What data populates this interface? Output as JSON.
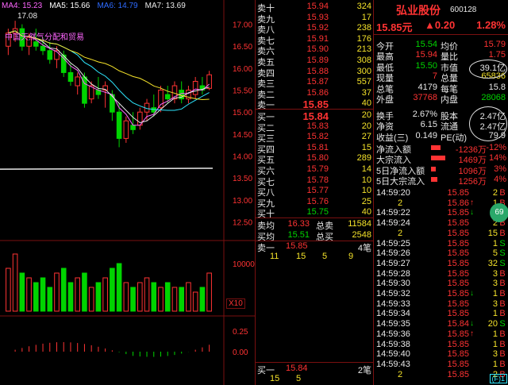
{
  "ma_legend": [
    {
      "label": "MA4: 15.23",
      "color": "#ff66ff"
    },
    {
      "label": "MA5: 15.66",
      "color": "#ffffff"
    },
    {
      "label": "MA6: 14.79",
      "color": "#2e6bff"
    },
    {
      "label": "MA7: 13.69",
      "color": "#e8e8e8"
    }
  ],
  "chart": {
    "high_marker": "17.08",
    "overlay_text": "中国天然气分配和贸易",
    "price_axis": [
      "17.00",
      "16.50",
      "16.00",
      "15.50",
      "15.00",
      "14.50",
      "14.00",
      "13.50",
      "13.00",
      "12.50"
    ],
    "volume_axis": [
      "10000"
    ],
    "volume_unit": "X10",
    "macd_axis": [
      "0.25",
      "0.00"
    ],
    "period_label": "日线"
  },
  "chart_data": {
    "type": "candlestick",
    "candles": [
      {
        "o": 16.5,
        "h": 16.9,
        "l": 16.3,
        "c": 16.8
      },
      {
        "o": 16.8,
        "h": 17.08,
        "l": 16.6,
        "c": 16.9
      },
      {
        "o": 16.9,
        "h": 17.0,
        "l": 16.4,
        "c": 16.5
      },
      {
        "o": 16.5,
        "h": 16.8,
        "l": 16.3,
        "c": 16.7
      },
      {
        "o": 16.6,
        "h": 16.9,
        "l": 16.4,
        "c": 16.5
      },
      {
        "o": 16.5,
        "h": 16.7,
        "l": 16.3,
        "c": 16.4
      },
      {
        "o": 16.4,
        "h": 16.6,
        "l": 16.1,
        "c": 16.2
      },
      {
        "o": 16.2,
        "h": 16.5,
        "l": 16.0,
        "c": 16.4
      },
      {
        "o": 16.3,
        "h": 16.4,
        "l": 15.8,
        "c": 15.9
      },
      {
        "o": 15.9,
        "h": 16.1,
        "l": 15.6,
        "c": 15.7
      },
      {
        "o": 15.6,
        "h": 15.9,
        "l": 15.4,
        "c": 15.8
      },
      {
        "o": 15.8,
        "h": 15.9,
        "l": 15.1,
        "c": 15.2
      },
      {
        "o": 15.3,
        "h": 15.7,
        "l": 15.2,
        "c": 15.6
      },
      {
        "o": 15.5,
        "h": 15.8,
        "l": 15.3,
        "c": 15.4
      },
      {
        "o": 15.5,
        "h": 15.7,
        "l": 15.1,
        "c": 15.6
      },
      {
        "o": 15.4,
        "h": 15.5,
        "l": 14.8,
        "c": 15.0
      },
      {
        "o": 15.0,
        "h": 15.2,
        "l": 14.2,
        "c": 14.4
      },
      {
        "o": 14.4,
        "h": 14.9,
        "l": 14.3,
        "c": 14.8
      },
      {
        "o": 14.7,
        "h": 15.0,
        "l": 14.5,
        "c": 14.6
      },
      {
        "o": 14.7,
        "h": 15.1,
        "l": 14.6,
        "c": 15.0
      },
      {
        "o": 15.0,
        "h": 15.3,
        "l": 14.8,
        "c": 15.2
      },
      {
        "o": 15.1,
        "h": 15.4,
        "l": 14.9,
        "c": 15.0
      },
      {
        "o": 15.1,
        "h": 15.6,
        "l": 15.0,
        "c": 15.5
      },
      {
        "o": 15.4,
        "h": 15.6,
        "l": 15.2,
        "c": 15.3
      },
      {
        "o": 15.3,
        "h": 15.7,
        "l": 15.2,
        "c": 15.6
      },
      {
        "o": 15.5,
        "h": 15.7,
        "l": 15.2,
        "c": 15.3
      },
      {
        "o": 15.3,
        "h": 15.6,
        "l": 15.2,
        "c": 15.5
      },
      {
        "o": 15.4,
        "h": 15.8,
        "l": 15.3,
        "c": 15.7
      },
      {
        "o": 15.6,
        "h": 15.8,
        "l": 15.4,
        "c": 15.5
      },
      {
        "o": 15.54,
        "h": 15.94,
        "l": 15.5,
        "c": 15.85
      }
    ],
    "volumes": [
      9,
      12,
      8,
      7,
      6,
      7,
      5,
      8,
      9,
      6,
      7,
      8,
      5,
      6,
      7,
      9,
      10,
      6,
      5,
      6,
      7,
      6,
      5,
      6,
      5,
      5,
      6,
      4,
      5,
      8
    ],
    "price_range": [
      12.4,
      17.3
    ],
    "volume_max": 14
  },
  "order_book": {
    "asks": [
      {
        "label": "卖十",
        "price": "15.94",
        "vol": "324"
      },
      {
        "label": "卖九",
        "price": "15.93",
        "vol": "17"
      },
      {
        "label": "卖八",
        "price": "15.92",
        "vol": "238"
      },
      {
        "label": "卖七",
        "price": "15.91",
        "vol": "176"
      },
      {
        "label": "卖六",
        "price": "15.90",
        "vol": "213"
      },
      {
        "label": "卖五",
        "price": "15.89",
        "vol": "308"
      },
      {
        "label": "卖四",
        "price": "15.88",
        "vol": "300"
      },
      {
        "label": "卖三",
        "price": "15.87",
        "vol": "557"
      },
      {
        "label": "卖二",
        "price": "15.86",
        "vol": "37"
      },
      {
        "label": "卖一",
        "price": "15.85",
        "vol": "40"
      }
    ],
    "bids": [
      {
        "label": "买一",
        "price": "15.84",
        "vol": "20"
      },
      {
        "label": "买二",
        "price": "15.83",
        "vol": "20"
      },
      {
        "label": "买三",
        "price": "15.82",
        "vol": "27"
      },
      {
        "label": "买四",
        "price": "15.81",
        "vol": "15"
      },
      {
        "label": "买五",
        "price": "15.80",
        "vol": "289"
      },
      {
        "label": "买六",
        "price": "15.79",
        "vol": "14"
      },
      {
        "label": "买七",
        "price": "15.78",
        "vol": "10"
      },
      {
        "label": "买八",
        "price": "15.77",
        "vol": "10"
      },
      {
        "label": "买九",
        "price": "15.76",
        "vol": "25"
      },
      {
        "label": "买十",
        "price": "15.75",
        "vol": "40"
      }
    ],
    "sell_avg_label": "卖均",
    "sell_avg": "16.33",
    "total_sell_label": "总卖",
    "total_sell": "11584",
    "buy_avg_label": "买均",
    "buy_avg": "15.51",
    "total_buy_label": "总买",
    "total_buy": "2548",
    "queue_sell": {
      "label": "卖一",
      "price": "15.85",
      "count": "4笔",
      "items": [
        "11",
        "15",
        "5",
        "9"
      ]
    },
    "queue_buy": {
      "label": "买一",
      "price": "15.84",
      "count": "2笔",
      "items": [
        "15",
        "5"
      ]
    }
  },
  "quote": {
    "name": "弘业股份",
    "code": "600128",
    "price": "15.85元",
    "change": "▲0.20",
    "pct": "1.28%",
    "rows": [
      {
        "k": "今开",
        "v": "15.54",
        "vc": "#00d400",
        "k2": "均价",
        "v2": "15.79",
        "v2c": "#ff3333"
      },
      {
        "k": "最高",
        "v": "15.94",
        "vc": "#ff3333",
        "k2": "量比",
        "v2": "1.75",
        "v2c": "#ff3333"
      },
      {
        "k": "最低",
        "v": "15.50",
        "vc": "#00d400",
        "k2": "市值",
        "v2": "39.1亿",
        "v2c": "#e8e8e8"
      },
      {
        "k": "现量",
        "v": "7",
        "vc": "#ff3333",
        "k2": "总量",
        "v2": "65836",
        "v2c": "#f5e32a"
      },
      {
        "k": "总笔",
        "v": "4179",
        "vc": "#e8e8e8",
        "k2": "每笔",
        "v2": "15.8",
        "v2c": "#e8e8e8"
      },
      {
        "k": "外盘",
        "v": "37768",
        "vc": "#ff3333",
        "k2": "内盘",
        "v2": "28068",
        "v2c": "#00d400"
      }
    ],
    "rows2": [
      {
        "k": "换手",
        "v": "2.67%",
        "vc": "#e8e8e8",
        "k2": "股本",
        "v2": "2.47亿",
        "v2c": "#e8e8e8"
      },
      {
        "k": "净资",
        "v": "6.15",
        "vc": "#e8e8e8",
        "k2": "流通",
        "v2": "2.47亿",
        "v2c": "#e8e8e8"
      },
      {
        "k": "收益(三)",
        "v": "0.149",
        "vc": "#e8e8e8",
        "k2": "PE(动)",
        "v2": "79.9",
        "v2c": "#e8e8e8"
      }
    ],
    "flows": [
      {
        "k": "净流入额",
        "v": "-1236万",
        "pct": "-12%",
        "bar": 0.3,
        "color": "#ff3333"
      },
      {
        "k": "大宗流入",
        "v": "1469万",
        "pct": "14%",
        "bar": 0.45,
        "color": "#ff3333"
      },
      {
        "k": "5日净流入额",
        "v": "1096万",
        "pct": "3%",
        "bar": 0.15,
        "color": "#ff3333"
      },
      {
        "k": "5日大宗流入",
        "v": "1256万",
        "pct": "4%",
        "bar": 0.2,
        "color": "#ff3333"
      }
    ],
    "ticks": [
      {
        "t": "14:59:20",
        "p": "15.85",
        "ar": "",
        "n": "2",
        "s": "B",
        "sc": "#ff3333"
      },
      {
        "t": "2",
        "p": "15.86",
        "ar": "↑",
        "n": "1",
        "s": "B",
        "sc": "#ff3333",
        "tc": "#f5e32a"
      },
      {
        "t": "14:59:22",
        "p": "15.85",
        "ar": "↓",
        "n": "7",
        "s": "B",
        "sc": "#ff3333"
      },
      {
        "t": "14:59:24",
        "p": "15.85",
        "ar": "",
        "n": "2",
        "s": "B",
        "sc": "#ff3333"
      },
      {
        "t": "2",
        "p": "15.85",
        "ar": "",
        "n": "15",
        "s": "B",
        "sc": "#ff3333",
        "tc": "#f5e32a"
      },
      {
        "t": "14:59:25",
        "p": "15.85",
        "ar": "",
        "n": "1",
        "s": "S",
        "sc": "#00d400"
      },
      {
        "t": "14:59:26",
        "p": "15.85",
        "ar": "",
        "n": "5",
        "s": "S",
        "sc": "#00d400"
      },
      {
        "t": "14:59:27",
        "p": "15.85",
        "ar": "",
        "n": "32",
        "s": "S",
        "sc": "#00d400"
      },
      {
        "t": "14:59:28",
        "p": "15.85",
        "ar": "",
        "n": "3",
        "s": "B",
        "sc": "#ff3333"
      },
      {
        "t": "14:59:30",
        "p": "15.85",
        "ar": "",
        "n": "3",
        "s": "B",
        "sc": "#ff3333"
      },
      {
        "t": "14:59:32",
        "p": "15.85",
        "ar": "↓",
        "n": "1",
        "s": "B",
        "sc": "#ff3333"
      },
      {
        "t": "14:59:33",
        "p": "15.85",
        "ar": "",
        "n": "3",
        "s": "B",
        "sc": "#ff3333"
      },
      {
        "t": "14:59:34",
        "p": "15.85",
        "ar": "",
        "n": "1",
        "s": "B",
        "sc": "#ff3333"
      },
      {
        "t": "14:59:35",
        "p": "15.84",
        "ar": "↓",
        "n": "20",
        "s": "S",
        "sc": "#00d400"
      },
      {
        "t": "14:59:36",
        "p": "15.85",
        "ar": "↑",
        "n": "1",
        "s": "B",
        "sc": "#ff3333"
      },
      {
        "t": "14:59:38",
        "p": "15.85",
        "ar": "",
        "n": "1",
        "s": "B",
        "sc": "#ff3333"
      },
      {
        "t": "14:59:40",
        "p": "15.85",
        "ar": "",
        "n": "3",
        "s": "B",
        "sc": "#ff3333"
      },
      {
        "t": "14:59:43",
        "p": "15.85",
        "ar": "",
        "n": "1",
        "s": "B",
        "sc": "#ff3333"
      },
      {
        "t": "2",
        "p": "15.85",
        "ar": "",
        "n": "2",
        "s": "B",
        "sc": "#ff3333",
        "tc": "#f5e32a"
      }
    ],
    "bottom_link": "(F)1"
  }
}
